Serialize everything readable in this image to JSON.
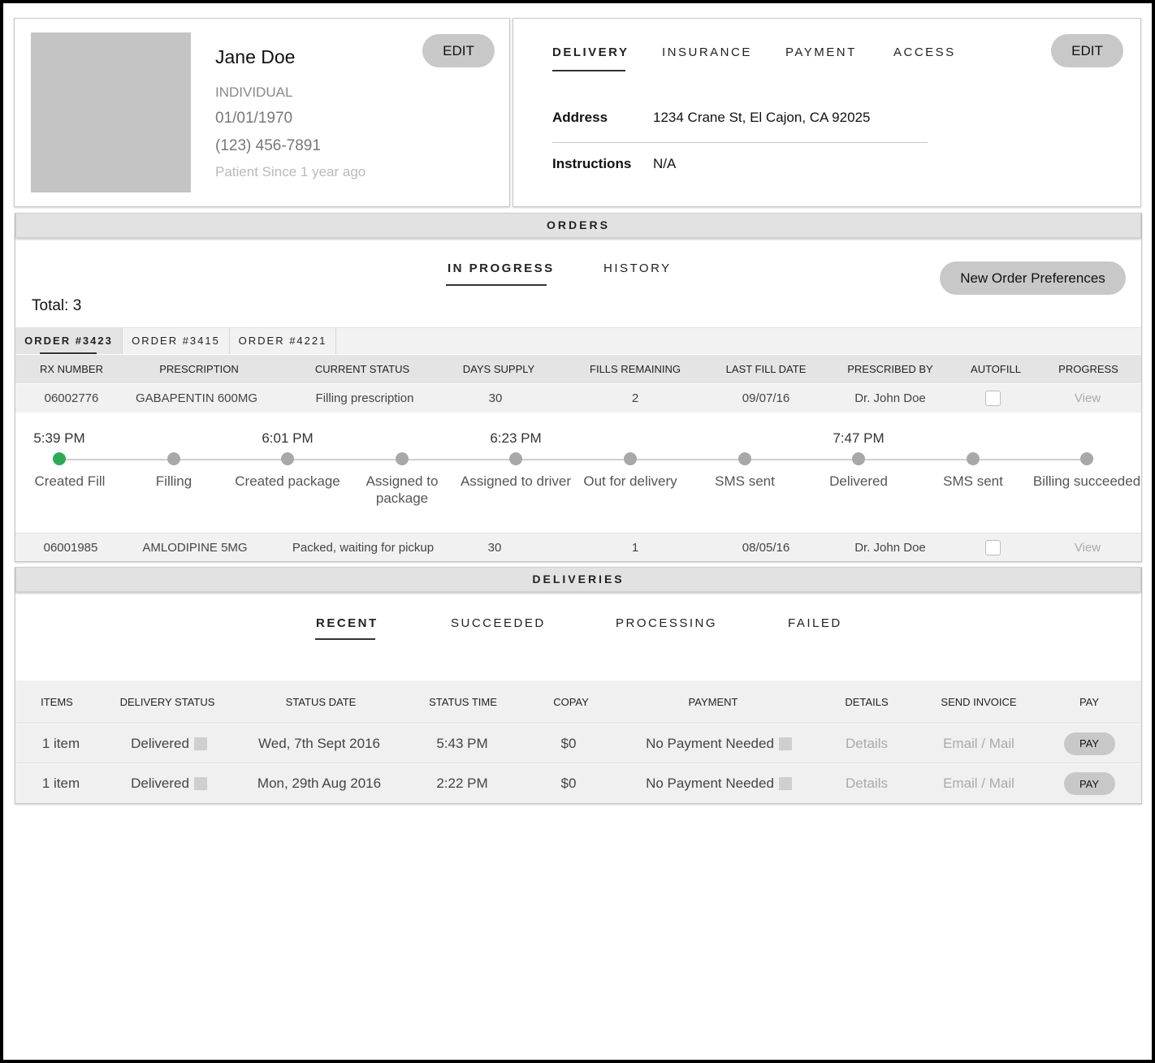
{
  "patient": {
    "name": "Jane Doe",
    "type": "INDIVIDUAL",
    "dob": "01/01/1970",
    "phone": "(123) 456-7891",
    "since": "Patient Since 1 year ago",
    "edit_label": "EDIT"
  },
  "info_panel": {
    "tabs": [
      "DELIVERY",
      "INSURANCE",
      "PAYMENT",
      "ACCESS"
    ],
    "active_tab": "DELIVERY",
    "edit_label": "EDIT",
    "address_label": "Address",
    "address_value": "1234 Crane St, El Cajon, CA 92025",
    "instructions_label": "Instructions",
    "instructions_value": "N/A"
  },
  "orders": {
    "title": "ORDERS",
    "tabs": [
      "IN PROGRESS",
      "HISTORY"
    ],
    "active_tab": "IN PROGRESS",
    "preferences_button": "New Order Preferences",
    "total": "Total: 3",
    "order_tabs": [
      "ORDER #3423",
      "ORDER #3415",
      "ORDER #4221"
    ],
    "active_order": "ORDER #3423",
    "columns": [
      "RX NUMBER",
      "PRESCRIPTION",
      "CURRENT STATUS",
      "DAYS SUPPLY",
      "FILLS REMAINING",
      "LAST FILL DATE",
      "PRESCRIBED BY",
      "AUTOFILL",
      "PROGRESS"
    ],
    "rows": [
      {
        "rx": "06002776",
        "prescription": "GABAPENTIN 600MG",
        "status": "Filling prescription",
        "days": "30",
        "fills": "2",
        "last_fill": "09/07/16",
        "prescriber": "Dr. John Doe",
        "autofill": false,
        "progress": "View"
      },
      {
        "rx": "06001985",
        "prescription": "AMLODIPINE 5MG",
        "status": "Packed, waiting for pickup",
        "days": "30",
        "fills": "1",
        "last_fill": "08/05/16",
        "prescriber": "Dr. John Doe",
        "autofill": false,
        "progress": "View"
      }
    ],
    "timeline": {
      "steps": [
        {
          "time": "5:39 PM",
          "label": "Created Fill",
          "done": true
        },
        {
          "time": "",
          "label": "Filling",
          "done": false
        },
        {
          "time": "6:01 PM",
          "label": "Created package",
          "done": false
        },
        {
          "time": "",
          "label": "Assigned to package",
          "done": false
        },
        {
          "time": "6:23 PM",
          "label": "Assigned to driver",
          "done": false
        },
        {
          "time": "",
          "label": "Out for delivery",
          "done": false
        },
        {
          "time": "",
          "label": "SMS sent",
          "done": false
        },
        {
          "time": "7:47 PM",
          "label": "Delivered",
          "done": false
        },
        {
          "time": "",
          "label": "SMS sent",
          "done": false
        },
        {
          "time": "",
          "label": "Billing succeeded",
          "done": false
        }
      ],
      "done_color": "#2eaa57",
      "pending_color": "#a8a8a8"
    }
  },
  "deliveries": {
    "title": "DELIVERIES",
    "tabs": [
      "RECENT",
      "SUCCEEDED",
      "PROCESSING",
      "FAILED"
    ],
    "active_tab": "RECENT",
    "columns": [
      "ITEMS",
      "DELIVERY STATUS",
      "STATUS DATE",
      "STATUS TIME",
      "COPAY",
      "PAYMENT",
      "DETAILS",
      "SEND INVOICE",
      "PAY"
    ],
    "rows": [
      {
        "items": "1 item",
        "status": "Delivered",
        "date": "Wed, 7th Sept 2016",
        "time": "5:43 PM",
        "copay": "$0",
        "payment": "No Payment Needed",
        "details": "Details",
        "invoice": "Email / Mail",
        "pay": "PAY"
      },
      {
        "items": "1 item",
        "status": "Delivered",
        "date": "Mon, 29th Aug 2016",
        "time": "2:22 PM",
        "copay": "$0",
        "payment": "No Payment Needed",
        "details": "Details",
        "invoice": "Email / Mail",
        "pay": "PAY"
      }
    ]
  }
}
